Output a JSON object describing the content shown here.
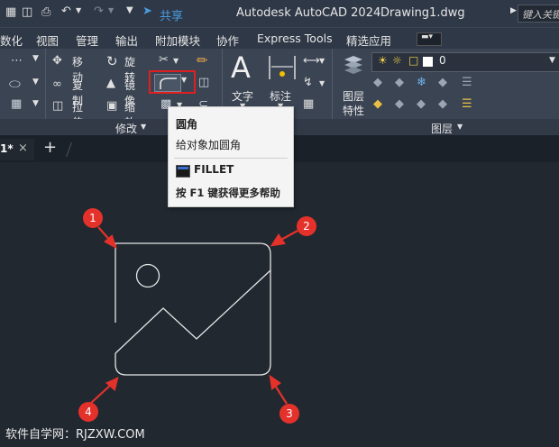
{
  "title_bar": {
    "share_label": "共享",
    "app_title": "Autodesk AutoCAD 2024",
    "file_name": "Drawing1.dwg",
    "search_placeholder": "键入关键"
  },
  "menu": [
    "数化",
    "视图",
    "管理",
    "输出",
    "附加模块",
    "协作",
    "Express Tools",
    "精选应用"
  ],
  "ribbon": {
    "modify_tools": [
      "移动",
      "旋转",
      "复制",
      "镜像",
      "拉伸",
      "缩放"
    ],
    "text_label": "文字",
    "dim_label": "标注",
    "layer_props_label": [
      "图层",
      "特性"
    ],
    "layer_value": "0",
    "panel_modify": "修改",
    "panel_layers": "图层"
  },
  "file_tab": {
    "label": "1*",
    "close": "×",
    "new": "+"
  },
  "tooltip": {
    "title": "圆角",
    "description": "给对象加圆角",
    "command": "FILLET",
    "help": "按 F1 键获得更多帮助"
  },
  "markers": [
    "1",
    "2",
    "3",
    "4"
  ],
  "watermark": "软件自学网：RJZXW.COM",
  "colors": {
    "highlight": "#e02020",
    "accent": "#4a9be0",
    "marker": "#e4322b"
  }
}
